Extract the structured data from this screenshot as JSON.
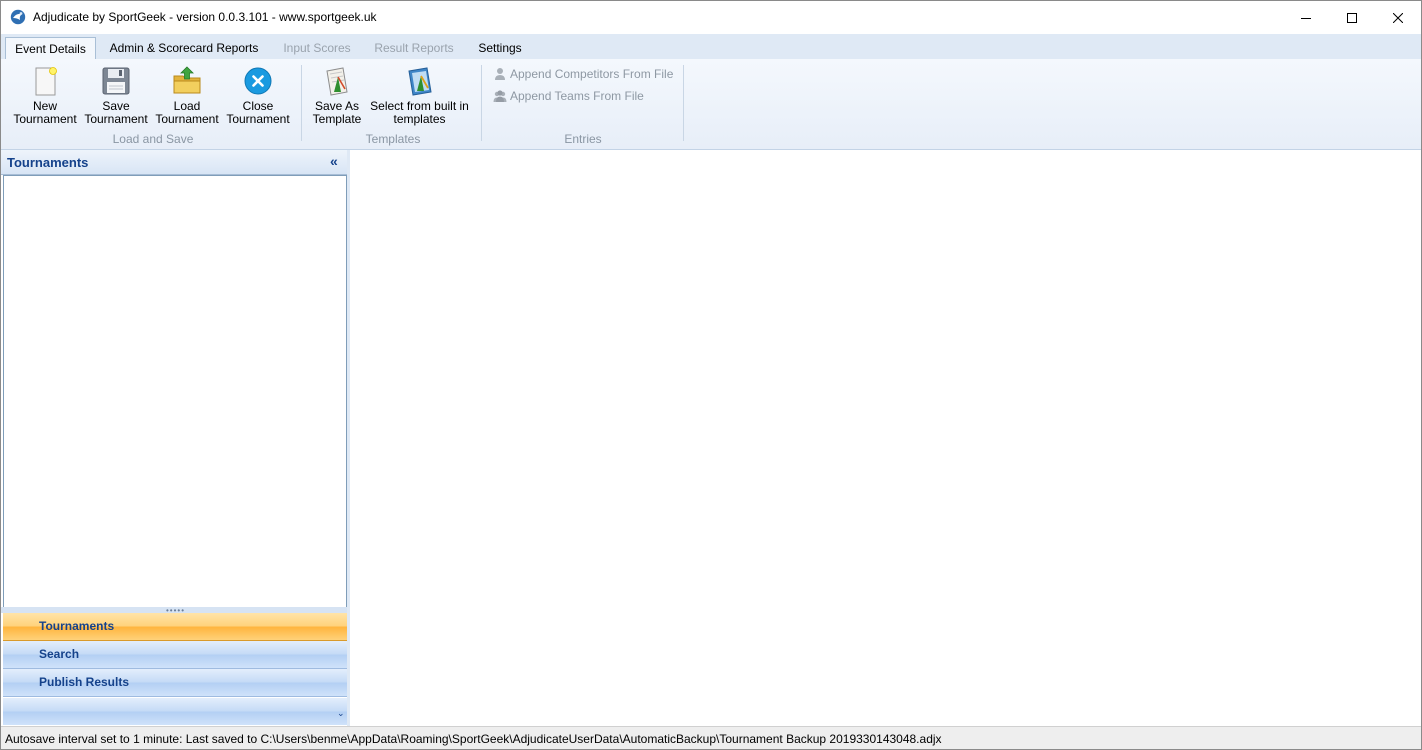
{
  "window": {
    "title": "Adjudicate by SportGeek -  version 0.0.3.101 - www.sportgeek.uk",
    "icon": "sportgeek-logo-icon",
    "controls": {
      "minimize": "minimize-icon",
      "maximize": "maximize-icon",
      "close": "close-icon"
    }
  },
  "tabs": [
    {
      "label": "Event Details",
      "active": true,
      "enabled": true
    },
    {
      "label": "Admin & Scorecard Reports",
      "active": false,
      "enabled": true
    },
    {
      "label": "Input Scores",
      "active": false,
      "enabled": false
    },
    {
      "label": "Result Reports",
      "active": false,
      "enabled": false
    },
    {
      "label": "Settings",
      "active": false,
      "enabled": true
    }
  ],
  "ribbon": {
    "load_save": {
      "label": "Load and Save",
      "buttons": [
        {
          "line1": "New",
          "line2": "Tournament",
          "icon": "new-document-icon"
        },
        {
          "line1": "Save",
          "line2": "Tournament",
          "icon": "floppy-disk-icon"
        },
        {
          "line1": "Load",
          "line2": "Tournament",
          "icon": "open-folder-icon"
        },
        {
          "line1": "Close",
          "line2": "Tournament",
          "icon": "close-circle-icon"
        }
      ]
    },
    "templates": {
      "label": "Templates",
      "buttons": [
        {
          "line1": "Save As",
          "line2": "Template",
          "icon": "template-save-icon"
        },
        {
          "line1": "Select from built in",
          "line2": "templates",
          "icon": "template-select-icon"
        }
      ]
    },
    "entries": {
      "label": "Entries",
      "items": [
        {
          "label": "Append Competitors From File",
          "icon": "person-icon",
          "enabled": false
        },
        {
          "label": "Append Teams From File",
          "icon": "group-icon",
          "enabled": false
        }
      ]
    }
  },
  "nav_pane": {
    "header": "Tournaments",
    "collapse_glyph": "«",
    "splitter_grip": "•••••",
    "buttons": [
      {
        "label": "Tournaments",
        "selected": true
      },
      {
        "label": "Search",
        "selected": false
      },
      {
        "label": "Publish Results",
        "selected": false
      }
    ],
    "overflow_glyph": "⌄"
  },
  "status": {
    "text": "Autosave interval set to 1 minute: Last saved to C:\\Users\\benme\\AppData\\Roaming\\SportGeek\\AdjudicateUserData\\AutomaticBackup\\Tournament Backup 2019330143048.adjx"
  }
}
